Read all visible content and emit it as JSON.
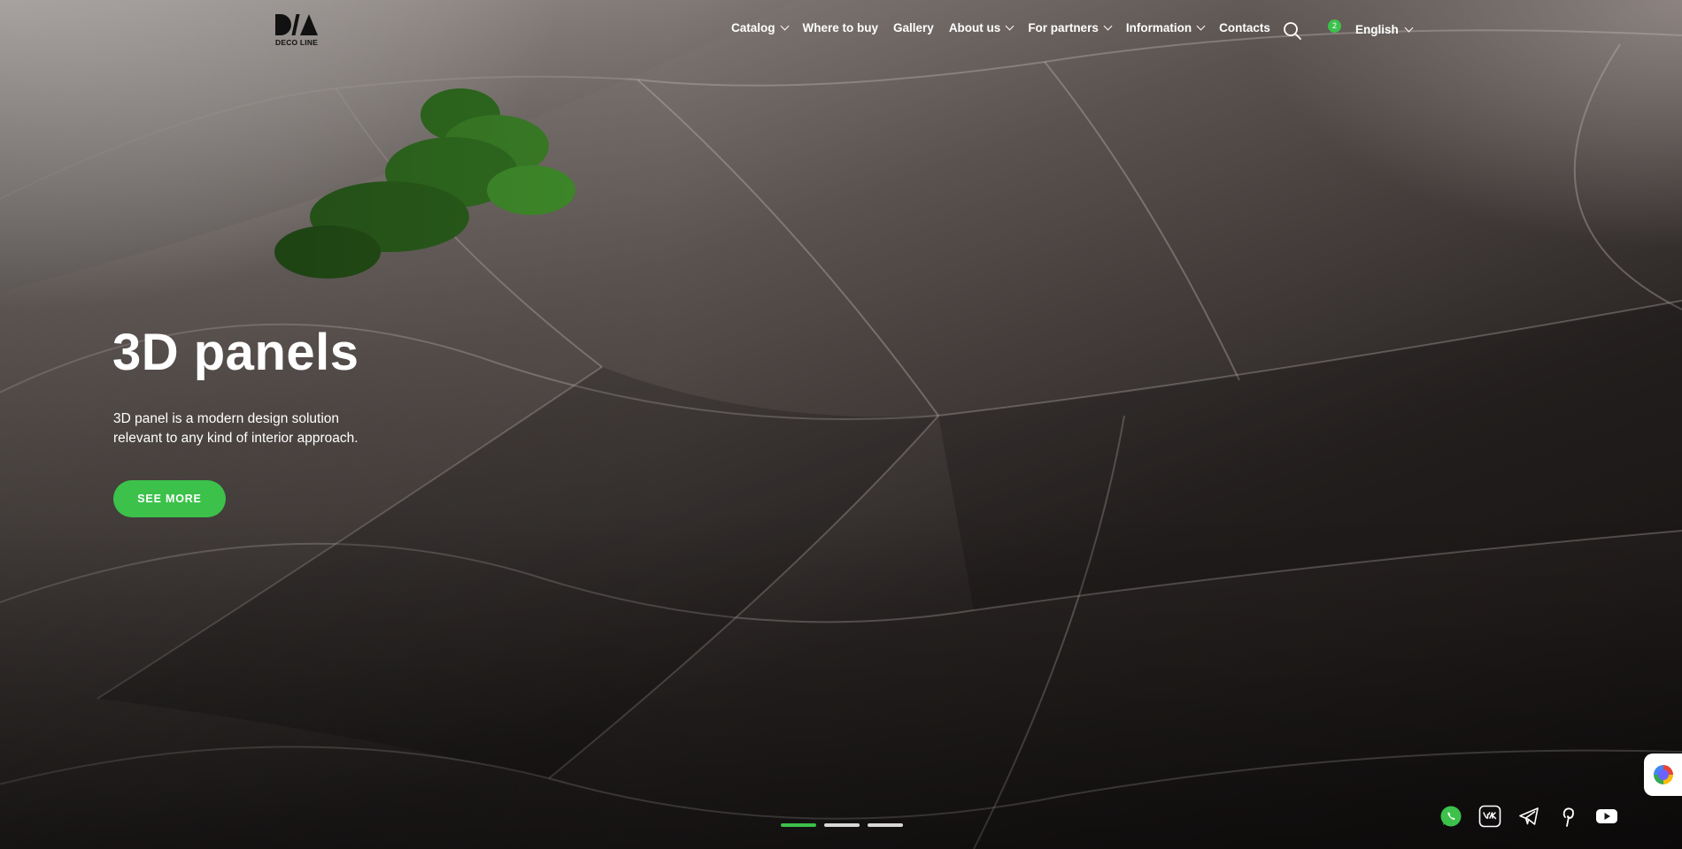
{
  "brand": {
    "logo_text": "DECO LINE"
  },
  "nav": {
    "items": [
      {
        "label": "Catalog",
        "has_dropdown": true
      },
      {
        "label": "Where to buy",
        "has_dropdown": false
      },
      {
        "label": "Gallery",
        "has_dropdown": false
      },
      {
        "label": "About us",
        "has_dropdown": true
      },
      {
        "label": "For partners",
        "has_dropdown": true
      },
      {
        "label": "Information",
        "has_dropdown": true
      },
      {
        "label": "Contacts",
        "has_dropdown": false
      }
    ]
  },
  "header": {
    "search_icon": "search-icon",
    "cart_count": "2",
    "language": "English"
  },
  "hero": {
    "title": "3D panels",
    "description_line1": "3D panel is a modern design solution",
    "description_line2": "relevant to any kind of interior approach.",
    "cta_label": "SEE MORE"
  },
  "slider": {
    "slide_count": 3,
    "active_index": 0
  },
  "socials": [
    "whatsapp-icon",
    "vk-icon",
    "telegram-icon",
    "pinterest-icon",
    "youtube-icon"
  ],
  "colors": {
    "accent": "#3cc14b",
    "text": "#ffffff"
  }
}
